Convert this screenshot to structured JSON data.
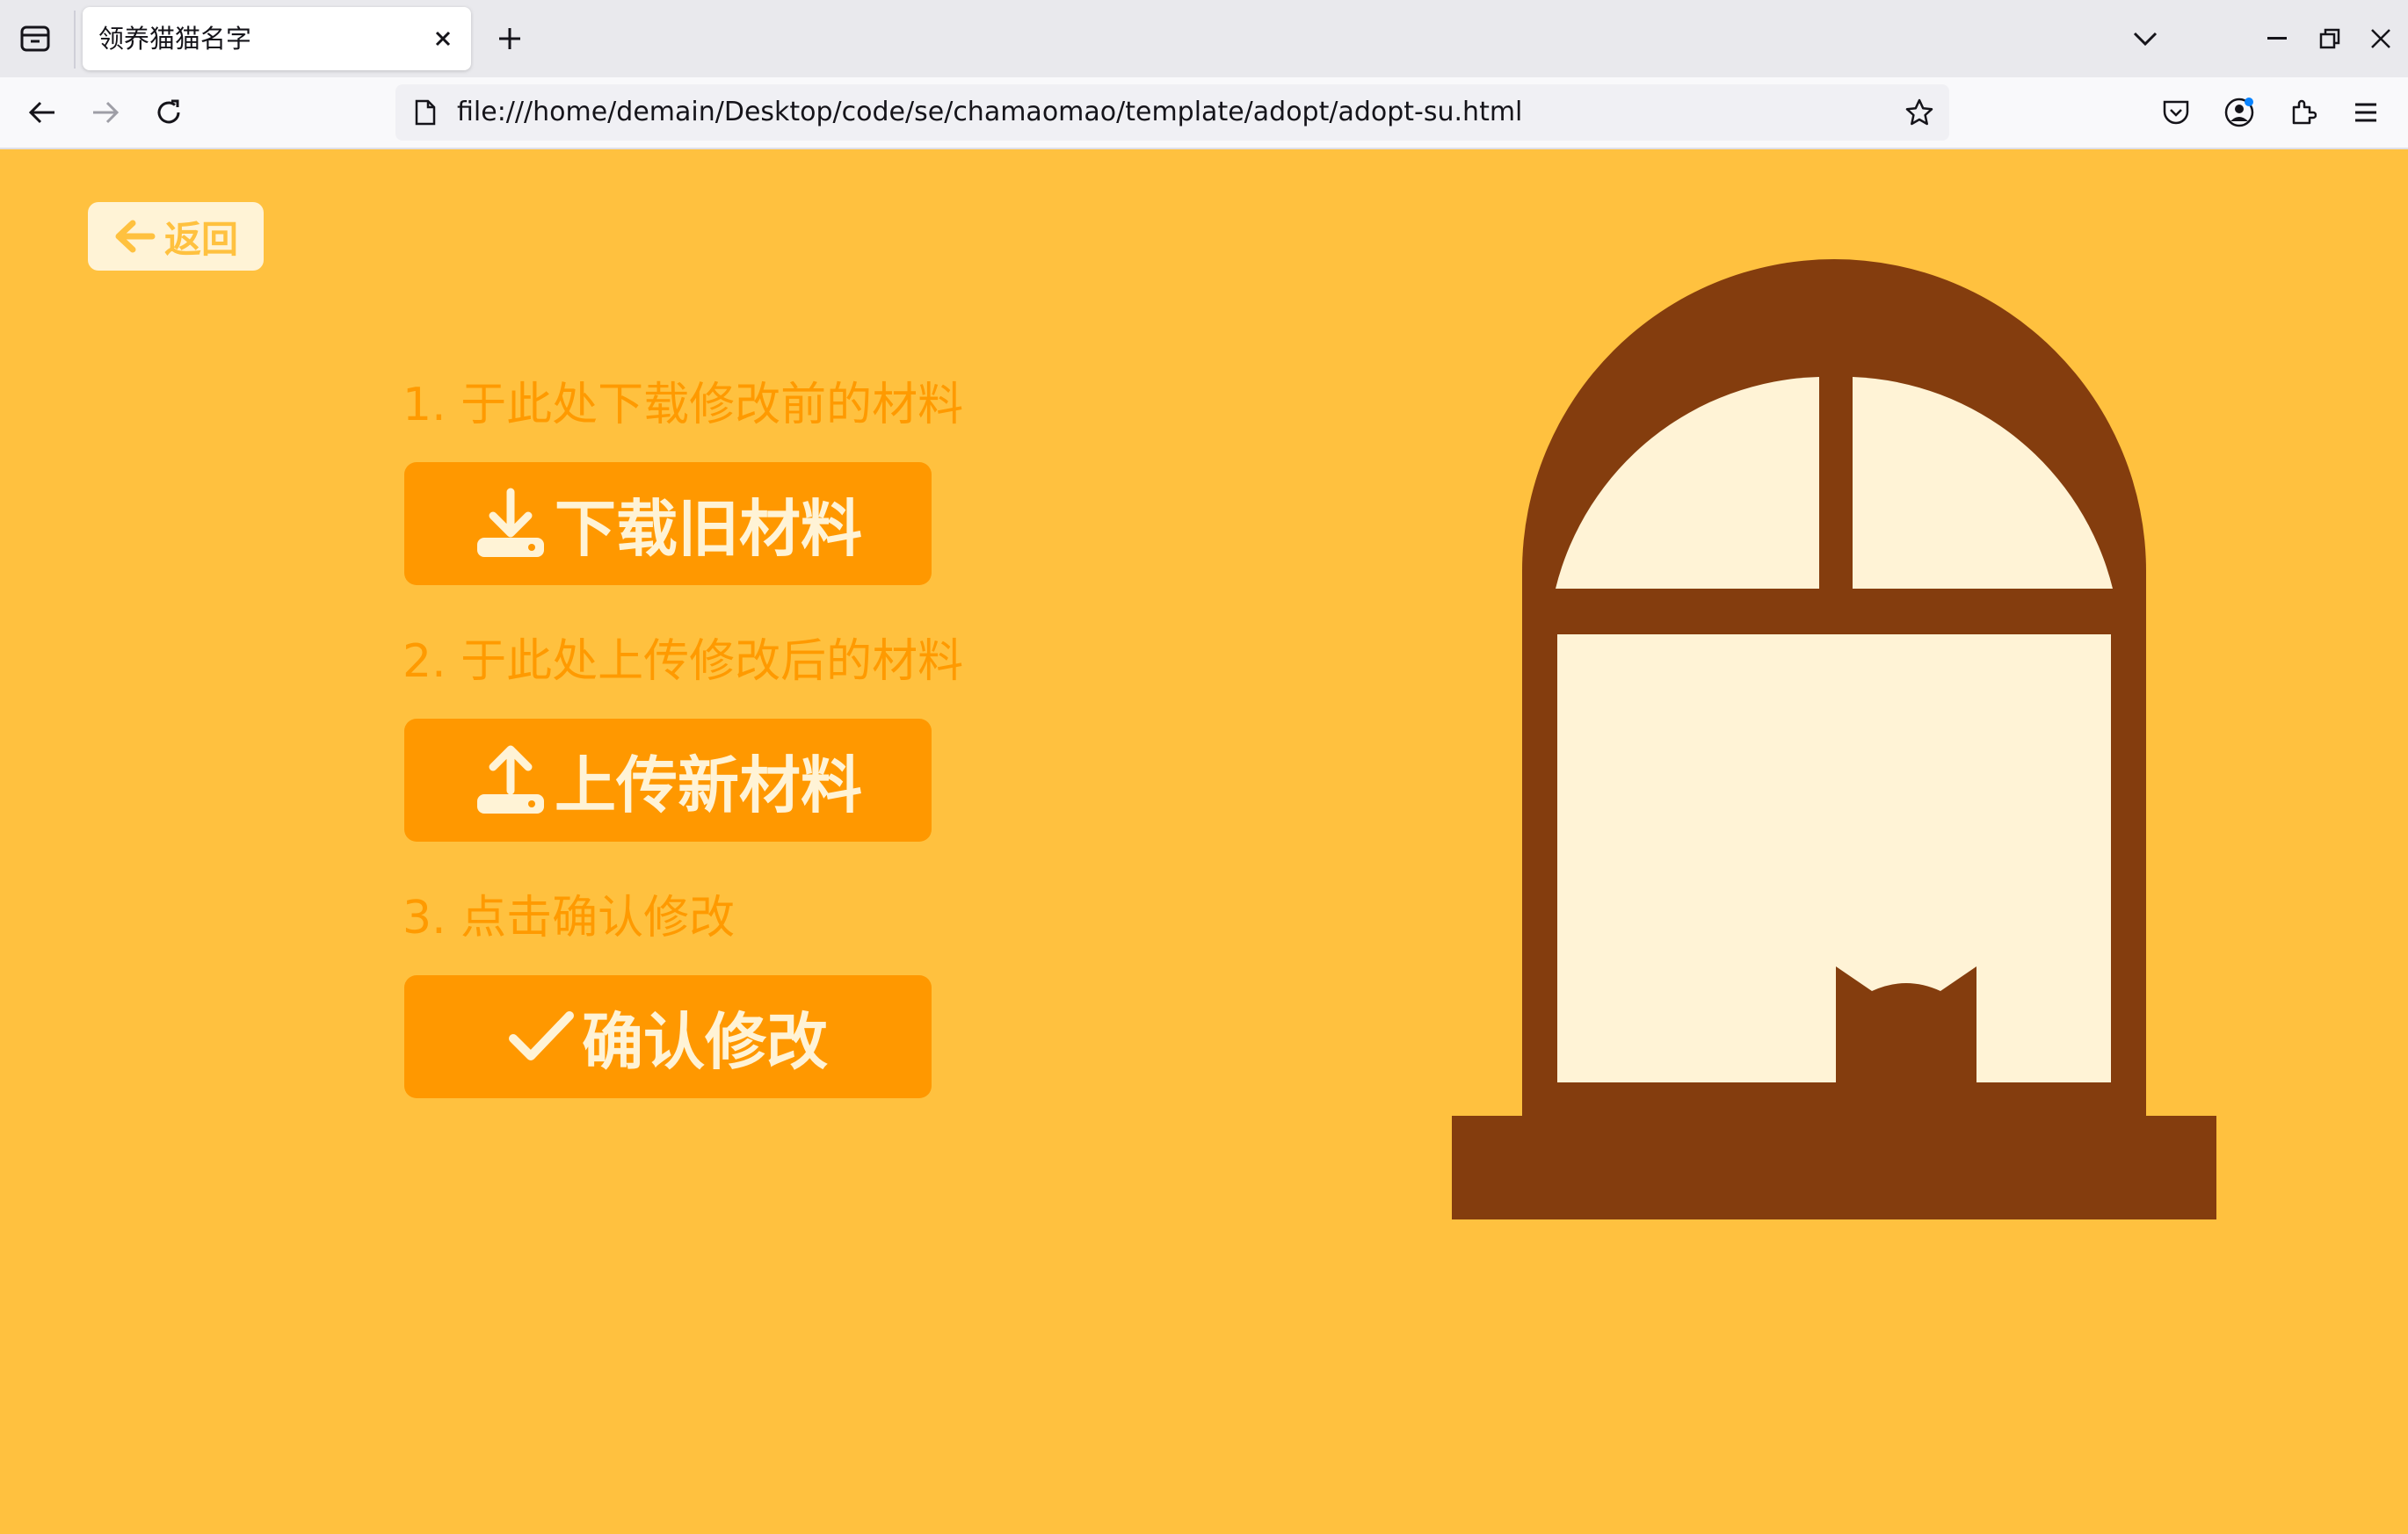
{
  "browser": {
    "tab_title": "领养猫猫名字",
    "url": "file:///home/demain/Desktop/code/se/chamaomao/template/adopt/adopt-su.html"
  },
  "page": {
    "back_label": "返回",
    "steps": [
      {
        "label": "1. 于此处下载修改前的材料",
        "button": "下载旧材料",
        "icon": "download-icon"
      },
      {
        "label": "2. 于此处上传修改后的材料",
        "button": "上传新材料",
        "icon": "upload-icon"
      },
      {
        "label": "3. 点击确认修改",
        "button": "确认修改",
        "icon": "check-icon"
      }
    ]
  },
  "colors": {
    "background": "#ffc13f",
    "accent": "#ff9800",
    "label": "#ff9a00",
    "button_text": "#fff3d6",
    "window_frame": "#843d0e",
    "window_glass": "#fff3d6"
  }
}
